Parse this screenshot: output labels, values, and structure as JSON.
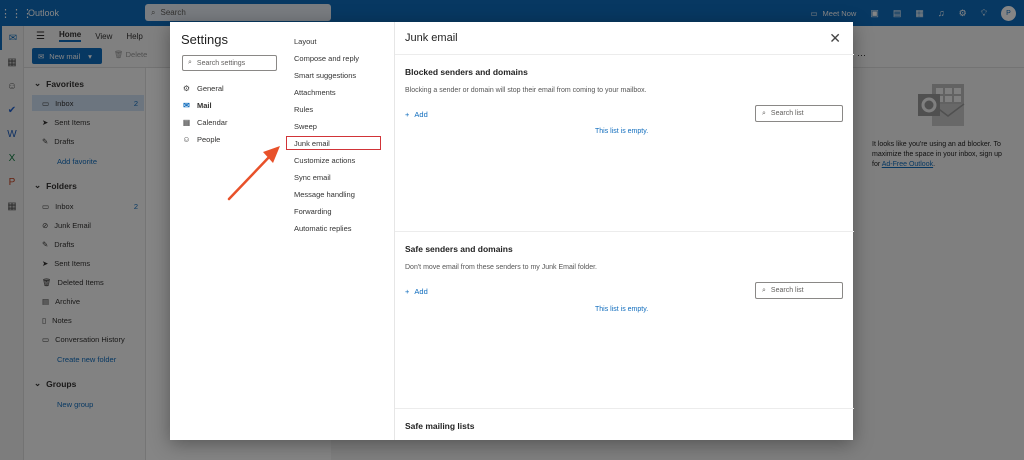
{
  "app": {
    "name": "Outlook",
    "search_placeholder": "Search",
    "meet_now": "Meet Now",
    "avatar_initial": "P"
  },
  "ribbon": {
    "tabs": [
      "Home",
      "View",
      "Help"
    ],
    "new_mail": "New mail",
    "delete": "Delete"
  },
  "folders": {
    "favorites_header": "Favorites",
    "favorites": [
      {
        "label": "Inbox",
        "count": "2"
      },
      {
        "label": "Sent Items",
        "count": ""
      },
      {
        "label": "Drafts",
        "count": ""
      }
    ],
    "add_favorite": "Add favorite",
    "folders_header": "Folders",
    "items": [
      {
        "label": "Inbox",
        "count": "2"
      },
      {
        "label": "Junk Email",
        "count": ""
      },
      {
        "label": "Drafts",
        "count": ""
      },
      {
        "label": "Sent Items",
        "count": ""
      },
      {
        "label": "Deleted Items",
        "count": ""
      },
      {
        "label": "Archive",
        "count": ""
      },
      {
        "label": "Notes",
        "count": ""
      },
      {
        "label": "Conversation History",
        "count": ""
      }
    ],
    "create_folder": "Create new folder",
    "groups_header": "Groups",
    "new_group": "New group"
  },
  "adblock": {
    "text": "It looks like you're using an ad blocker. To maximize the space in your inbox, sign up for ",
    "link": "Ad-Free Outlook",
    "tail": "."
  },
  "settings": {
    "title": "Settings",
    "search_placeholder": "Search settings",
    "categories": [
      "General",
      "Mail",
      "Calendar",
      "People"
    ],
    "subcategories": [
      "Layout",
      "Compose and reply",
      "Smart suggestions",
      "Attachments",
      "Rules",
      "Sweep",
      "Junk email",
      "Customize actions",
      "Sync email",
      "Message handling",
      "Forwarding",
      "Automatic replies"
    ],
    "page_title": "Junk email",
    "blocked": {
      "header": "Blocked senders and domains",
      "desc": "Blocking a sender or domain will stop their email from coming to your mailbox.",
      "add": "Add",
      "search": "Search list",
      "empty": "This list is empty."
    },
    "safe": {
      "header": "Safe senders and domains",
      "desc": "Don't move email from these senders to my Junk Email folder.",
      "add": "Add",
      "search": "Search list",
      "empty": "This list is empty."
    },
    "mailing": {
      "header": "Safe mailing lists"
    }
  },
  "colors": {
    "brand": "#0f6cbd",
    "highlight": "#d13438",
    "arrow": "#e8512a"
  }
}
